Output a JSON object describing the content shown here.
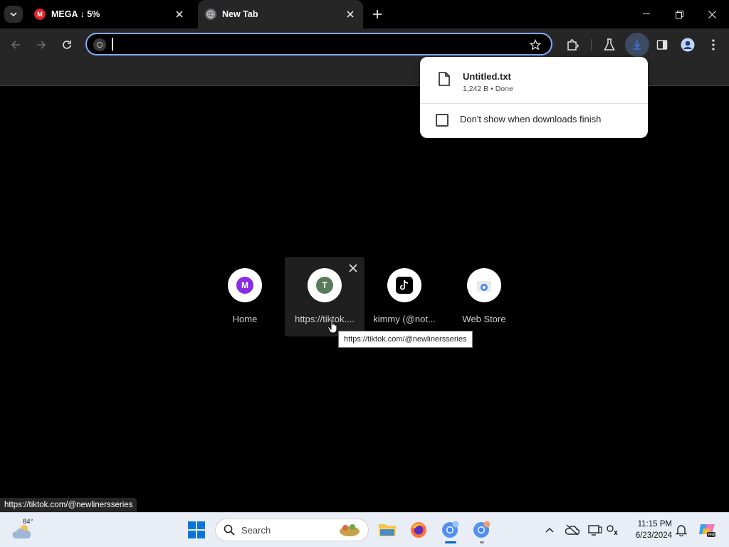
{
  "tabs": [
    {
      "title": "MEGA ↓ 5%",
      "favicon": "mega-icon",
      "active": false
    },
    {
      "title": "New Tab",
      "favicon": "globe-icon",
      "active": true
    }
  ],
  "omnibox": {
    "value": "",
    "placeholder": ""
  },
  "download_bubble": {
    "file_name": "Untitled.txt",
    "file_meta": "1,242 B • Done",
    "checkbox_label": "Don't show when downloads finish",
    "checkbox_checked": false
  },
  "shortcuts": [
    {
      "label": "Home",
      "icon_letter": "M",
      "icon_color": "#8b2be2"
    },
    {
      "label": "https://tiktok....",
      "icon_letter": "T",
      "icon_color": "#5a7a5a"
    },
    {
      "label": "kimmy (@not...",
      "icon": "tiktok-icon"
    },
    {
      "label": "Web Store",
      "icon": "webstore-icon"
    }
  ],
  "tooltip": "https://tiktok.com/@newlinersseries",
  "status_url": "https://tiktok.com/@newlinersseries",
  "taskbar": {
    "weather_temp": "84°",
    "search_label": "Search",
    "clock_time": "11:15 PM",
    "clock_date": "6/23/2024"
  },
  "colors": {
    "accent": "#7cacf8",
    "toolbar": "#262626",
    "background": "#000000"
  }
}
